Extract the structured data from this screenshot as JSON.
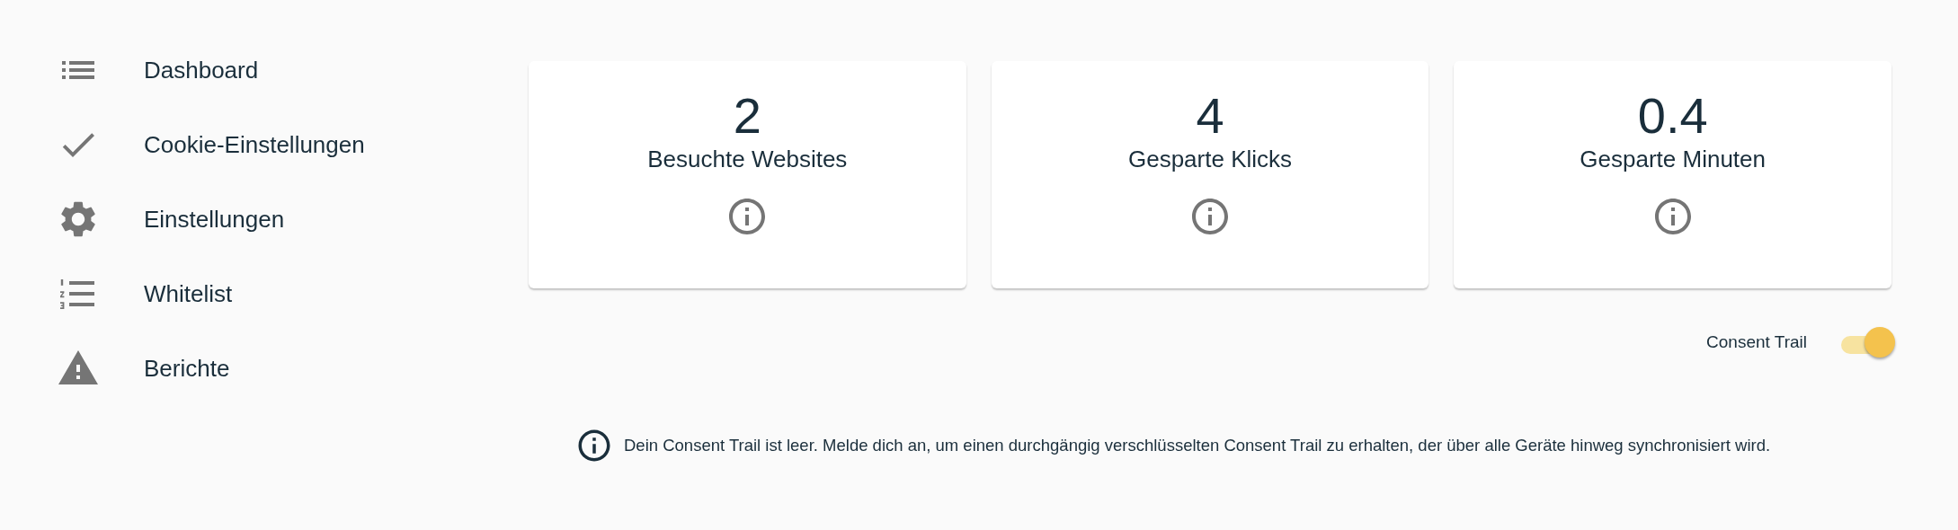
{
  "sidebar": {
    "items": [
      {
        "label": "Dashboard",
        "selected": false
      },
      {
        "label": "Cookie-Einstellungen",
        "selected": false
      },
      {
        "label": "Einstellungen",
        "selected": false
      },
      {
        "label": "Whitelist",
        "selected": false
      },
      {
        "label": "Berichte",
        "selected": false
      }
    ]
  },
  "stats": [
    {
      "value": "2",
      "label": "Besuchte Websites"
    },
    {
      "value": "4",
      "label": "Gesparte Klicks"
    },
    {
      "value": "0.4",
      "label": "Gesparte Minuten"
    }
  ],
  "consent_trail": {
    "label": "Consent Trail",
    "on": true
  },
  "notice": "Dein Consent Trail ist leer. Melde dich an, um einen durchgängig verschlüsselten Consent Trail zu erhalten, der über alle Geräte hinweg synchronisiert wird."
}
